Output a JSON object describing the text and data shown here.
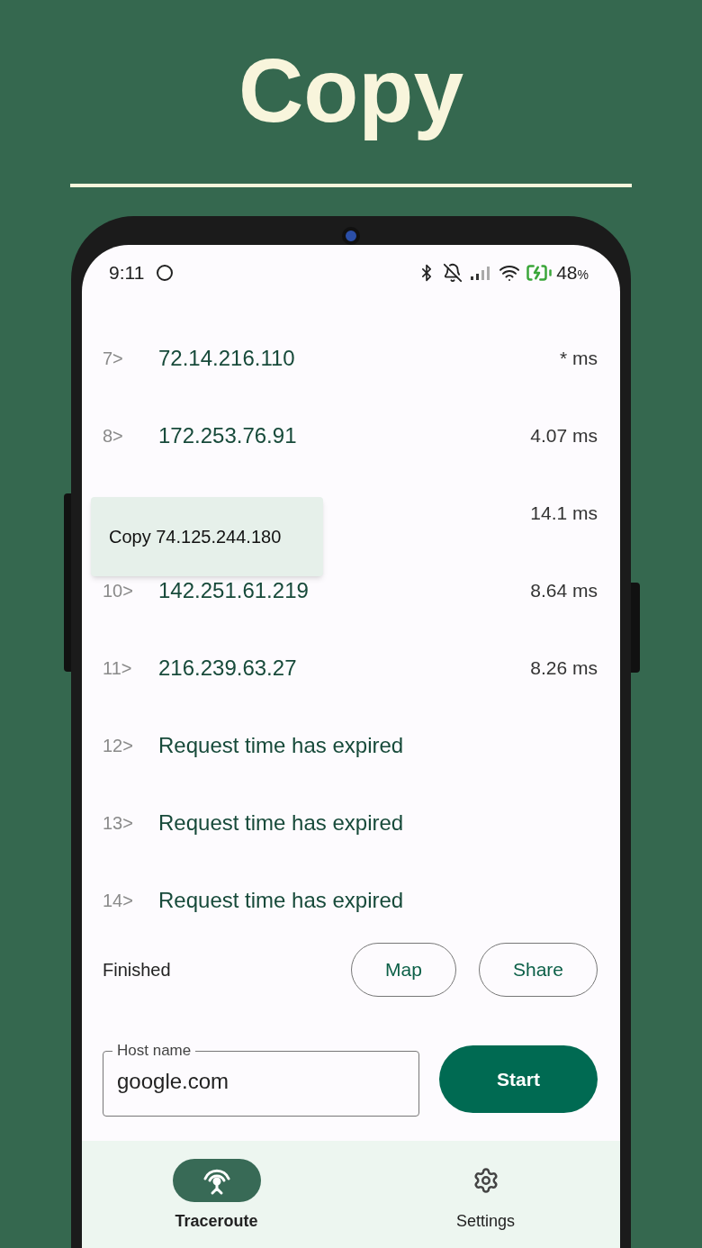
{
  "headline": "Copy",
  "status_bar": {
    "time": "9:11",
    "battery": "48",
    "battery_unit": "%"
  },
  "hops": [
    {
      "number": "7>",
      "address": "72.14.216.110",
      "time": "* ms"
    },
    {
      "number": "8>",
      "address": "172.253.76.91",
      "time": "4.07 ms"
    },
    {
      "time": "14.1 ms"
    },
    {
      "number": "10>",
      "address": "142.251.61.219",
      "time": "8.64 ms"
    },
    {
      "number": "11>",
      "address": "216.239.63.27",
      "time": "8.26 ms"
    },
    {
      "number": "12>",
      "address": "Request time has expired"
    },
    {
      "number": "13>",
      "address": "Request time has expired"
    },
    {
      "number": "14>",
      "address": "Request time has expired"
    }
  ],
  "context_menu": {
    "label": "Copy 74.125.244.180"
  },
  "status": "Finished",
  "actions": [
    "Map",
    "Share"
  ],
  "host_field": {
    "label": "Host name",
    "value": "google.com"
  },
  "start_button": "Start",
  "nav": [
    {
      "label": "Traceroute",
      "selected": true
    },
    {
      "label": "Settings",
      "selected": false
    }
  ]
}
